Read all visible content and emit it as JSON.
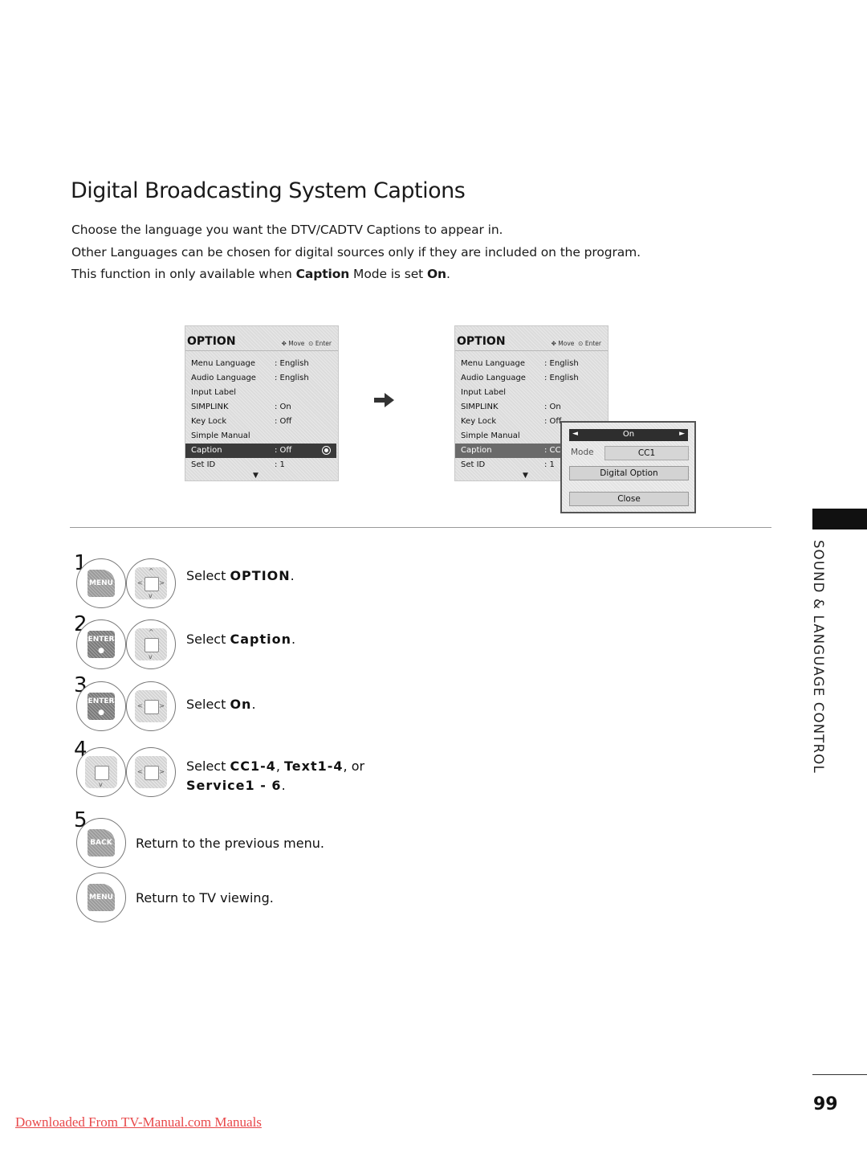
{
  "page": {
    "title": "Digital Broadcasting System Captions",
    "intro": [
      {
        "text": "Choose the language you want the DTV/CADTV Captions to appear in."
      },
      {
        "text": "Other Languages can be chosen for digital sources only if they are included on the program."
      },
      {
        "pre": "This function in only available when ",
        "b1": "Caption",
        "mid": " Mode is set ",
        "b2": "On",
        "post": "."
      }
    ]
  },
  "menu_before": {
    "title": "OPTION",
    "hint_move": "Move",
    "hint_enter": "Enter",
    "rows": [
      {
        "label": "Menu Language",
        "value": ": English"
      },
      {
        "label": "Audio Language",
        "value": ": English"
      },
      {
        "label": "Input Label",
        "value": ""
      },
      {
        "label": "SIMPLINK",
        "value": ": On"
      },
      {
        "label": "Key Lock",
        "value": ": Off"
      },
      {
        "label": "Simple Manual",
        "value": ""
      },
      {
        "label": "Caption",
        "value": ": Off"
      },
      {
        "label": "Set ID",
        "value": ": 1"
      }
    ]
  },
  "menu_after": {
    "title": "OPTION",
    "hint_move": "Move",
    "hint_enter": "Enter",
    "rows": [
      {
        "label": "Menu Language",
        "value": ": English"
      },
      {
        "label": "Audio Language",
        "value": ": English"
      },
      {
        "label": "Input Label",
        "value": ""
      },
      {
        "label": "SIMPLINK",
        "value": ": On"
      },
      {
        "label": "Key Lock",
        "value": ": Off"
      },
      {
        "label": "Simple Manual",
        "value": ""
      },
      {
        "label": "Caption",
        "value": ": CC"
      },
      {
        "label": "Set ID",
        "value": ": 1"
      }
    ],
    "popup": {
      "state": "On",
      "mode_label": "Mode",
      "mode_value": "CC1",
      "digital_option": "Digital Option",
      "close": "Close"
    }
  },
  "steps": [
    {
      "num": "1",
      "keys": [
        "MENU",
        "dpad"
      ],
      "pre": "Select ",
      "bold": "OPTION",
      "post": "."
    },
    {
      "num": "2",
      "keys": [
        "ENTER",
        "dpad-ud"
      ],
      "pre": "Select ",
      "bold": "Caption",
      "post": "."
    },
    {
      "num": "3",
      "keys": [
        "ENTER",
        "dpad-lr"
      ],
      "pre": "Select ",
      "bold": "On",
      "post": "."
    },
    {
      "num": "4",
      "keys": [
        "dpad-d",
        "dpad-lr"
      ],
      "pre": "Select ",
      "bold": "CC1-4",
      "mid": ", ",
      "bold2": "Text1-4",
      "mid2": ", or",
      "bold3": "Service1 - 6",
      "post": "."
    },
    {
      "num": "5",
      "keys": [
        "BACK"
      ],
      "text": "Return to the previous menu."
    },
    {
      "num": "",
      "keys": [
        "MENU"
      ],
      "text": "Return to TV viewing."
    }
  ],
  "keys": {
    "menu": "MENU",
    "enter": "ENTER",
    "back": "BACK"
  },
  "sidebar": {
    "section": "SOUND & LANGUAGE CONTROL"
  },
  "footer": {
    "page_number": "99",
    "link": "Downloaded From TV-Manual.com Manuals"
  },
  "colors": {
    "link": "#e8484a",
    "selected_row": "#3a3a3a"
  }
}
